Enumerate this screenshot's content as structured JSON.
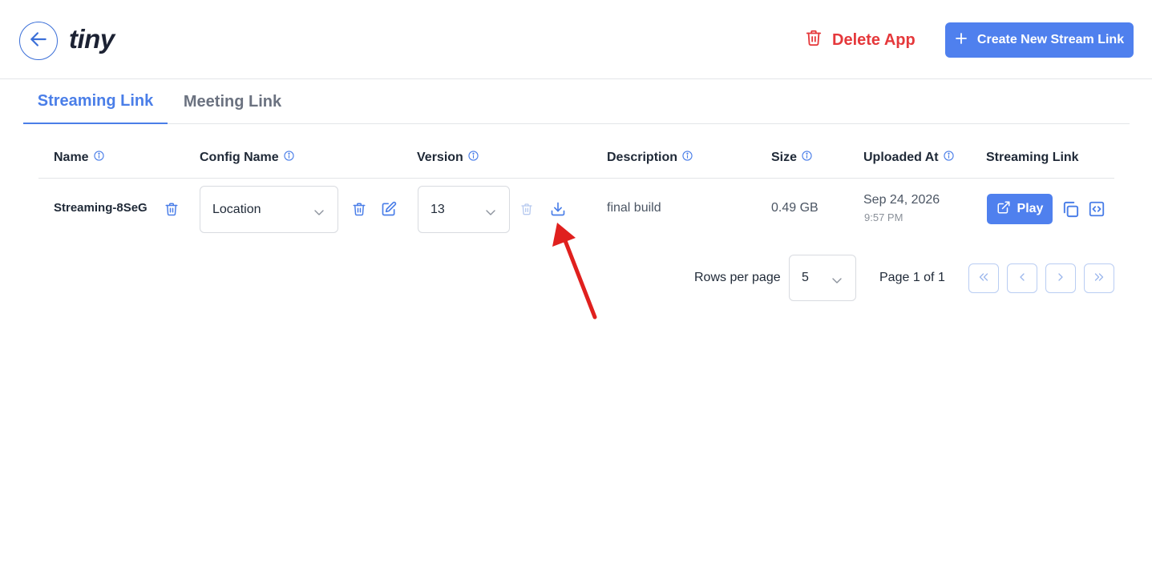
{
  "header": {
    "logo_text": "tiny",
    "delete_app_label": "Delete App",
    "create_button_label": "Create New Stream Link"
  },
  "tabs": [
    {
      "label": "Streaming Link",
      "active": true
    },
    {
      "label": "Meeting Link",
      "active": false
    }
  ],
  "table": {
    "columns": [
      "Name",
      "Config Name",
      "Version",
      "Description",
      "Size",
      "Uploaded At",
      "Streaming Link"
    ],
    "rows": [
      {
        "name": "Streaming-8SeG",
        "config_name": "Location",
        "version": "13",
        "description": "final build",
        "size": "0.49 GB",
        "uploaded_date": "Sep 24, 2026",
        "uploaded_time": "9:57 PM",
        "play_label": "Play"
      }
    ]
  },
  "pagination": {
    "rows_per_page_label": "Rows per page",
    "rows_per_page_value": "5",
    "page_info": "Page 1 of 1"
  },
  "colors": {
    "accent": "#4f80ee",
    "danger": "#e5383b",
    "annotation_arrow": "#e0201e"
  },
  "icons": [
    "arrow-left-icon",
    "trash-icon",
    "plus-icon",
    "info-icon",
    "edit-icon",
    "download-icon",
    "chevron-down-icon",
    "external-link-icon",
    "copy-icon",
    "code-icon",
    "chevrons-left-icon",
    "chevron-left-icon",
    "chevron-right-icon",
    "chevrons-right-icon"
  ]
}
